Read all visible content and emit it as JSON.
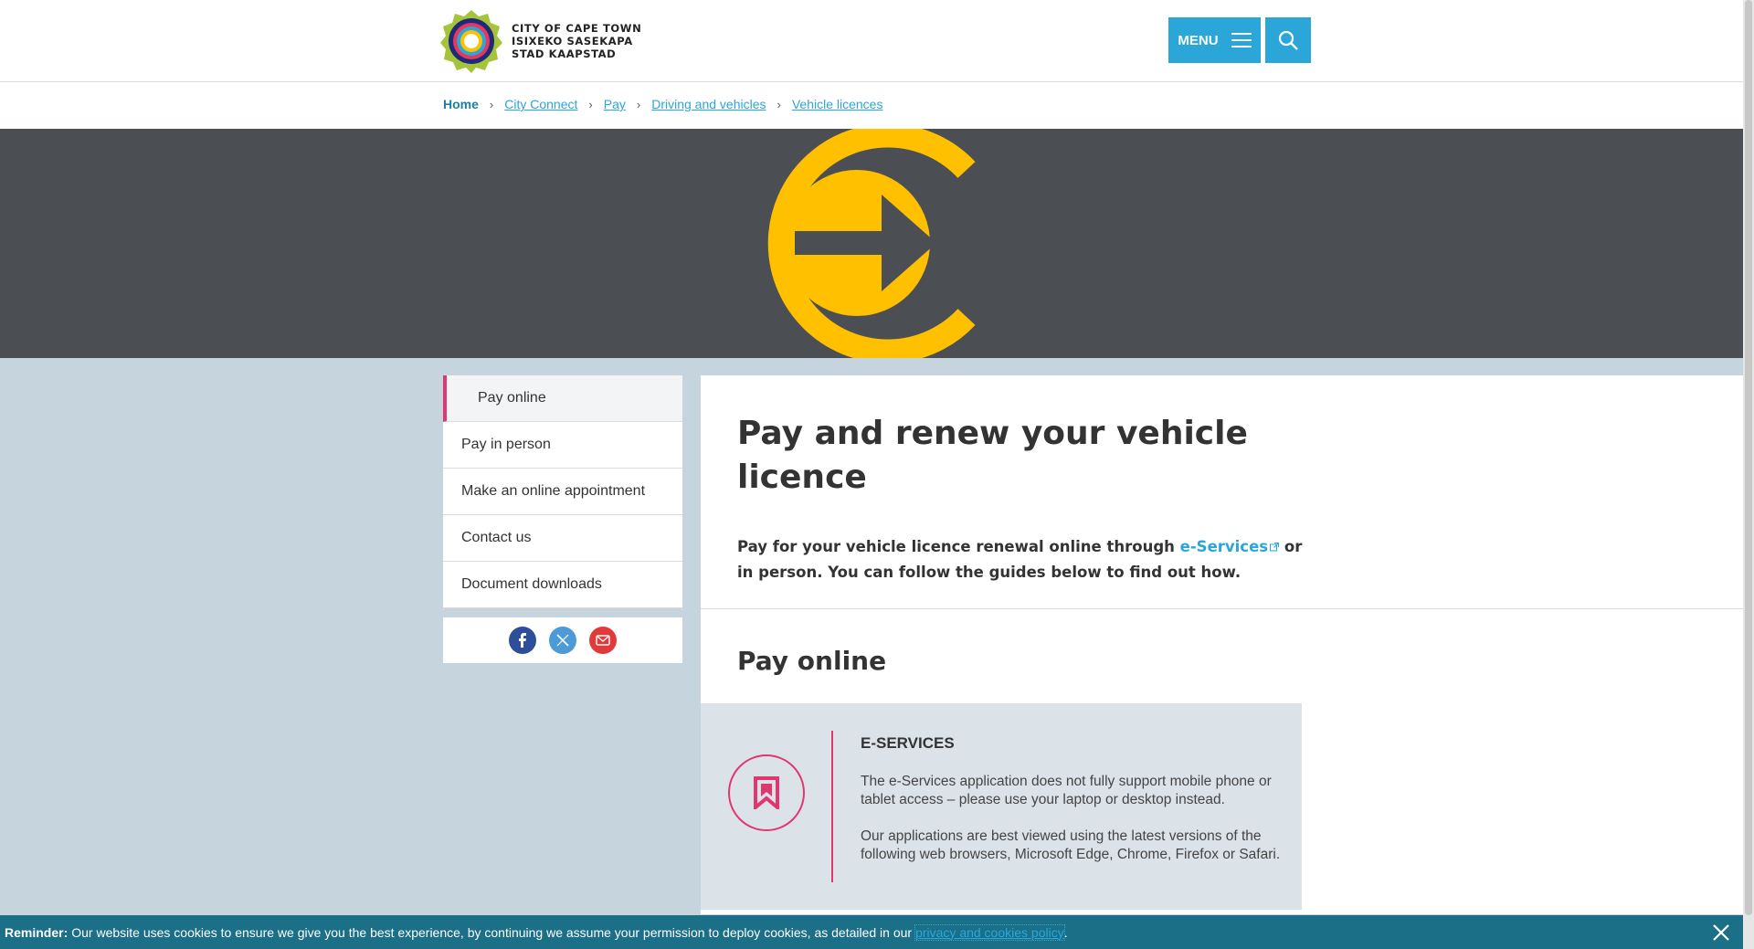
{
  "header": {
    "logo_lines": [
      "CITY OF CAPE TOWN",
      "ISIXEKO SASEKAPA",
      "STAD KAAPSTAD"
    ],
    "menu_label": "MENU"
  },
  "breadcrumb": {
    "home": "Home",
    "items": [
      "City Connect",
      "Pay",
      "Driving and vehicles",
      "Vehicle licences"
    ]
  },
  "sidebar": {
    "items": [
      {
        "label": "Pay online",
        "active": true
      },
      {
        "label": "Pay in person"
      },
      {
        "label": "Make an online appointment"
      },
      {
        "label": "Contact us"
      },
      {
        "label": "Document downloads"
      }
    ],
    "share_icons": [
      "facebook-icon",
      "x-icon",
      "email-icon"
    ]
  },
  "main": {
    "title": "Pay and renew your vehicle licence",
    "intro_before": "Pay for your vehicle licence renewal online through ",
    "intro_link": "e-Services",
    "intro_after": " or in person. You can follow the guides below to find out how.",
    "section_title": "Pay online",
    "card": {
      "title": "E-SERVICES",
      "p1": "The e-Services application does not fully support mobile phone or tablet access – please use your laptop or desktop instead.",
      "p2": "Our applications are best viewed using the latest versions of the following web browsers, Microsoft Edge, Chrome, Firefox or Safari."
    }
  },
  "cookie": {
    "label": "Reminder:",
    "text": "Our website uses cookies to ensure we give you the best experience, by continuing we assume your permission to deploy cookies, as detailed in our",
    "link": "privacy and cookies policy",
    "end": "."
  },
  "colors": {
    "accent_blue": "#2aa7d8",
    "accent_pink": "#e2366f",
    "hero_bg": "#4b4f54",
    "hero_logo": "#ffc000",
    "cookie_bg": "#1b6f87"
  }
}
